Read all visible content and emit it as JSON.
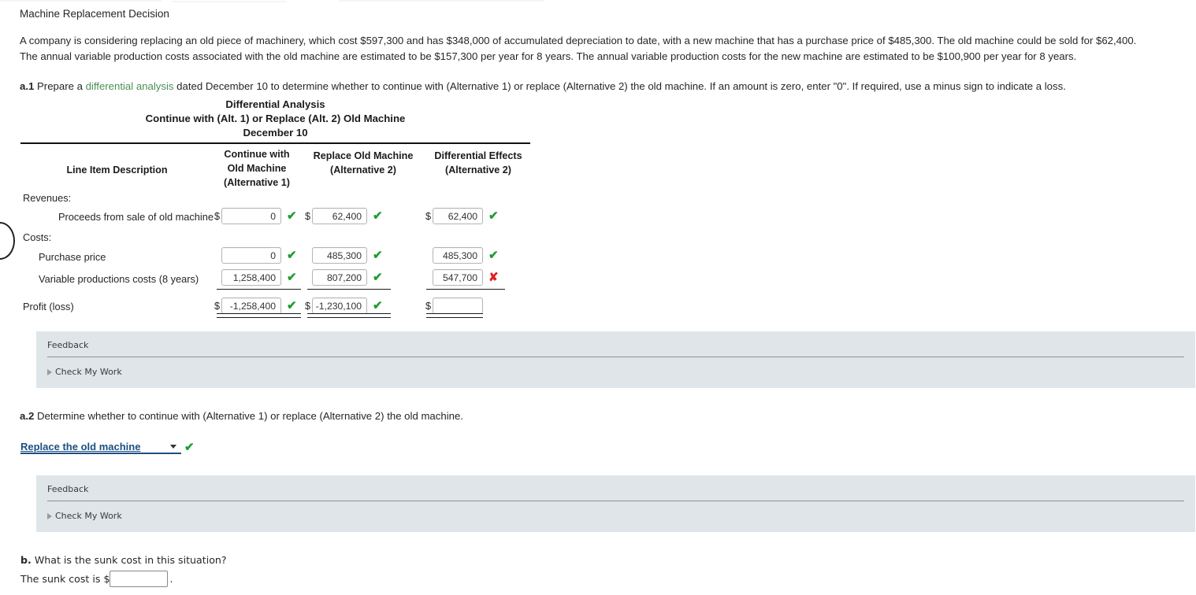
{
  "page": {
    "title": "Machine Replacement Decision",
    "paragraph_line1": "A company is considering replacing an old piece of machinery, which cost $597,300 and has $348,000 of accumulated depreciation to date, with a new machine that has a purchase price of $485,300. The old machine could be sold for $62,400.",
    "paragraph_line2": "The annual variable production costs associated with the old machine are estimated to be $157,300 per year for 8 years. The annual variable production costs for the new machine are estimated to be $100,900 per year for 8 years."
  },
  "question_a1": {
    "number": "a.1",
    "text_before_link": " Prepare a ",
    "link_text": "differential analysis",
    "text_after_link": " dated December 10 to determine whether to continue with (Alternative 1) or replace (Alternative 2) the old machine. If an amount is zero, enter \"0\". If required, use a minus sign to indicate a loss."
  },
  "table": {
    "title_line1": "Differential Analysis",
    "title_line2": "Continue with (Alt. 1) or Replace (Alt. 2) Old Machine",
    "title_line3": "December 10",
    "headers": {
      "description": "Line Item Description",
      "col1_line1": "Continue with",
      "col1_line2": "Old Machine",
      "col1_line3": "(Alternative 1)",
      "col2_line1": "Replace Old Machine",
      "col2_line2": "(Alternative 2)",
      "col3_line1": "Differential Effects",
      "col3_line2": "(Alternative 2)"
    },
    "sections": {
      "revenues": "Revenues:",
      "costs": "Costs:"
    },
    "rows": [
      {
        "label": "Proceeds from sale of old machine",
        "col1": {
          "value": "0",
          "dollar": true,
          "mark": "check"
        },
        "col2": {
          "value": "62,400",
          "dollar": true,
          "mark": "check"
        },
        "col3": {
          "value": "62,400",
          "dollar": true,
          "mark": "check"
        }
      },
      {
        "label": "Purchase price",
        "col1": {
          "value": "0",
          "dollar": false,
          "mark": "check"
        },
        "col2": {
          "value": "485,300",
          "dollar": false,
          "mark": "check"
        },
        "col3": {
          "value": "485,300",
          "dollar": false,
          "mark": "check"
        }
      },
      {
        "label": "Variable productions costs (8 years)",
        "col1": {
          "value": "1,258,400",
          "dollar": false,
          "mark": "check"
        },
        "col2": {
          "value": "807,200",
          "dollar": false,
          "mark": "check"
        },
        "col3": {
          "value": "547,700",
          "dollar": false,
          "mark": "cross"
        }
      },
      {
        "label": "Profit (loss)",
        "col1": {
          "value": "-1,258,400",
          "dollar": true,
          "mark": "check"
        },
        "col2": {
          "value": "-1,230,100",
          "dollar": true,
          "mark": "check"
        },
        "col3": {
          "value": "",
          "dollar": true,
          "mark": "none"
        }
      }
    ]
  },
  "feedback": {
    "title": "Feedback",
    "check_my_work": "Check My Work"
  },
  "question_a2": {
    "number": "a.2",
    "text": " Determine whether to continue with (Alternative 1) or replace (Alternative 2) the old machine.",
    "dropdown_value": "Replace the old machine",
    "mark": "check"
  },
  "question_b": {
    "number": "b.",
    "text": " What is the sunk cost in this situation?",
    "answer_prefix": "The sunk cost is $",
    "answer_value": "",
    "answer_suffix": "."
  },
  "glyphs": {
    "check": "✔",
    "cross": "✘"
  },
  "colors": {
    "check_green": "#1f9d2f",
    "cross_red": "#dd2222",
    "link_green": "#4a8f56",
    "dropdown_navy": "#1c4f82",
    "feedback_bg": "#dfe5e8"
  }
}
